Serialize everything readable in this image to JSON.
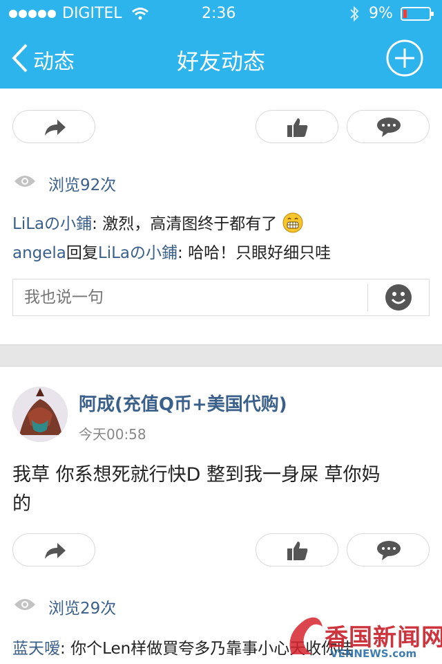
{
  "status_bar": {
    "carrier": "DIGITEL",
    "time": "2:36",
    "battery": "9%",
    "colors": {
      "bar": "#2eb4ec",
      "battery_low": "#ff3b30"
    }
  },
  "nav": {
    "back_label": "动态",
    "title": "好友动态",
    "add_icon": "plus-circle-icon"
  },
  "post1": {
    "views_label": "浏览92次",
    "comments": [
      {
        "author": "LiLaの小鋪",
        "sep": ": ",
        "text": "激烈，高清图终于都有了"
      },
      {
        "author": "angela",
        "reply_word": "回复",
        "target": "LiLaの小鋪",
        "sep": ": ",
        "text": "哈哈！只眼好细只哇"
      }
    ],
    "comment_placeholder": "我也说一句"
  },
  "post2": {
    "username": "阿成(充值Q币+美国代购)",
    "timestamp": "今天00:58",
    "content_line1": "我草 你系想死就行快D 整到我一身屎 草你妈",
    "content_line2": "的",
    "views_label": "浏览29次",
    "comments": [
      {
        "author": "蓝天嗳",
        "sep": ": ",
        "text": "你个Len样做買夸多乃靠事小心天收你哇"
      }
    ]
  },
  "watermark": {
    "text": "香国新闻网",
    "sub": "VENNEWS.com"
  }
}
